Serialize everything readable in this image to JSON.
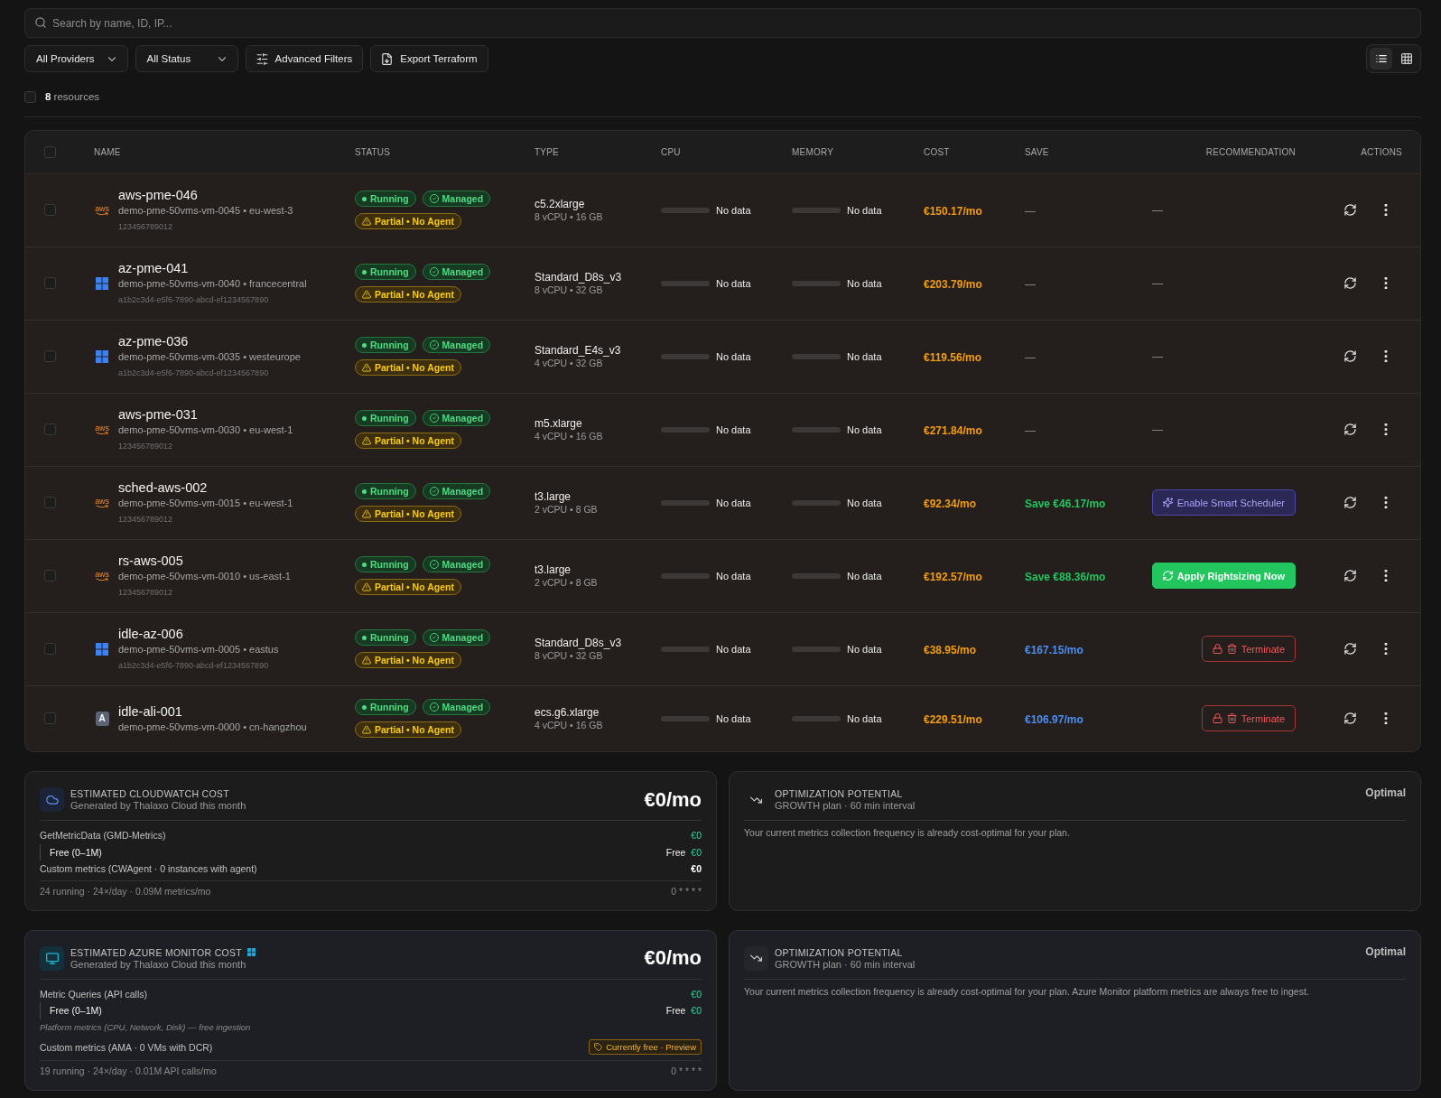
{
  "search": {
    "placeholder": "Search by name, ID, IP..."
  },
  "filters": [
    {
      "kind": "dropdown",
      "label": "All Providers"
    },
    {
      "kind": "dropdown",
      "label": "All Status"
    },
    {
      "kind": "filters",
      "label": "Advanced Filters"
    },
    {
      "kind": "export",
      "label": "Export Terraform"
    }
  ],
  "view_modes": [
    {
      "kind": "list",
      "selected": true
    },
    {
      "kind": "grid",
      "selected": false
    }
  ],
  "selection": {
    "checked": false,
    "count": "**8** resources"
  },
  "table": {
    "select_all": {
      "checked": false
    },
    "columns": [
      "NAME",
      "STATUS",
      "TYPE",
      "CPU",
      "MEMORY",
      "COST",
      "SAVE",
      "RECOMMENDATION",
      "ACTIONS"
    ],
    "rows": [
      {
        "checked": false,
        "provider": {
          "kind": "aws",
          "logo_text": "aws"
        },
        "name": "aws-pme-046",
        "detail": "demo-pme-50vms-vm-0045 • eu-west-3",
        "account": "123456789012",
        "badges": [
          {
            "kind": "running",
            "label": "Running"
          },
          {
            "kind": "managed",
            "label": "Managed"
          },
          {
            "kind": "partial",
            "label": "Partial • No Agent"
          }
        ],
        "type": "c5.2xlarge",
        "specs": "8 vCPU • 16 GB",
        "cpu": {
          "reading": "No data"
        },
        "memory": {
          "reading": "No data"
        },
        "cost": "€150.17/mo",
        "save": {
          "kind": "none",
          "text": "—"
        },
        "recommendation": {
          "kind": "none",
          "text": "—"
        }
      },
      {
        "checked": false,
        "provider": {
          "kind": "azure"
        },
        "name": "az-pme-041",
        "detail": "demo-pme-50vms-vm-0040 • francecentral",
        "account": "a1b2c3d4-e5f6-7890-abcd-ef1234567890",
        "badges": [
          {
            "kind": "running",
            "label": "Running"
          },
          {
            "kind": "managed",
            "label": "Managed"
          },
          {
            "kind": "partial",
            "label": "Partial • No Agent"
          }
        ],
        "type": "Standard_D8s_v3",
        "specs": "8 vCPU • 32 GB",
        "cpu": {
          "reading": "No data"
        },
        "memory": {
          "reading": "No data"
        },
        "cost": "€203.79/mo",
        "save": {
          "kind": "none",
          "text": "—"
        },
        "recommendation": {
          "kind": "none",
          "text": "—"
        }
      },
      {
        "checked": false,
        "provider": {
          "kind": "azure"
        },
        "name": "az-pme-036",
        "detail": "demo-pme-50vms-vm-0035 • westeurope",
        "account": "a1b2c3d4-e5f6-7890-abcd-ef1234567890",
        "badges": [
          {
            "kind": "running",
            "label": "Running"
          },
          {
            "kind": "managed",
            "label": "Managed"
          },
          {
            "kind": "partial",
            "label": "Partial • No Agent"
          }
        ],
        "type": "Standard_E4s_v3",
        "specs": "4 vCPU • 32 GB",
        "cpu": {
          "reading": "No data"
        },
        "memory": {
          "reading": "No data"
        },
        "cost": "€119.56/mo",
        "save": {
          "kind": "none",
          "text": "—"
        },
        "recommendation": {
          "kind": "none",
          "text": "—"
        }
      },
      {
        "checked": false,
        "provider": {
          "kind": "aws",
          "logo_text": "aws"
        },
        "name": "aws-pme-031",
        "detail": "demo-pme-50vms-vm-0030 • eu-west-1",
        "account": "123456789012",
        "badges": [
          {
            "kind": "running",
            "label": "Running"
          },
          {
            "kind": "managed",
            "label": "Managed"
          },
          {
            "kind": "partial",
            "label": "Partial • No Agent"
          }
        ],
        "type": "m5.xlarge",
        "specs": "4 vCPU • 16 GB",
        "cpu": {
          "reading": "No data"
        },
        "memory": {
          "reading": "No data"
        },
        "cost": "€271.84/mo",
        "save": {
          "kind": "none",
          "text": "—"
        },
        "recommendation": {
          "kind": "none",
          "text": "—"
        }
      },
      {
        "checked": false,
        "provider": {
          "kind": "aws",
          "logo_text": "aws"
        },
        "name": "sched-aws-002",
        "detail": "demo-pme-50vms-vm-0015 • eu-west-1",
        "account": "123456789012",
        "badges": [
          {
            "kind": "running",
            "label": "Running"
          },
          {
            "kind": "managed",
            "label": "Managed"
          },
          {
            "kind": "partial",
            "label": "Partial • No Agent"
          }
        ],
        "type": "t3.large",
        "specs": "2 vCPU • 8 GB",
        "cpu": {
          "reading": "No data"
        },
        "memory": {
          "reading": "No data"
        },
        "cost": "€92.34/mo",
        "save": {
          "kind": "saving",
          "text": "Save €46.17/mo"
        },
        "recommendation": {
          "kind": "scheduler",
          "text": "Enable Smart Scheduler"
        }
      },
      {
        "checked": false,
        "provider": {
          "kind": "aws",
          "logo_text": "aws"
        },
        "name": "rs-aws-005",
        "detail": "demo-pme-50vms-vm-0010 • us-east-1",
        "account": "123456789012",
        "badges": [
          {
            "kind": "running",
            "label": "Running"
          },
          {
            "kind": "managed",
            "label": "Managed"
          },
          {
            "kind": "partial",
            "label": "Partial • No Agent"
          }
        ],
        "type": "t3.large",
        "specs": "2 vCPU • 8 GB",
        "cpu": {
          "reading": "No data"
        },
        "memory": {
          "reading": "No data"
        },
        "cost": "€192.57/mo",
        "save": {
          "kind": "saving",
          "text": "Save €88.36/mo"
        },
        "recommendation": {
          "kind": "rightsizing",
          "text": "Apply Rightsizing Now"
        }
      },
      {
        "checked": false,
        "provider": {
          "kind": "azure"
        },
        "name": "idle-az-006",
        "detail": "demo-pme-50vms-vm-0005 • eastus",
        "account": "a1b2c3d4-e5f6-7890-abcd-ef1234567890",
        "badges": [
          {
            "kind": "running",
            "label": "Running"
          },
          {
            "kind": "managed",
            "label": "Managed"
          },
          {
            "kind": "partial",
            "label": "Partial • No Agent"
          }
        ],
        "type": "Standard_D8s_v3",
        "specs": "8 vCPU • 32 GB",
        "cpu": {
          "reading": "No data"
        },
        "memory": {
          "reading": "No data"
        },
        "cost": "€38.95/mo",
        "save": {
          "kind": "idle",
          "text": "€167.15/mo"
        },
        "recommendation": {
          "kind": "terminate",
          "text": "Terminate"
        }
      },
      {
        "checked": false,
        "provider": {
          "kind": "alibaba",
          "logo_text": "A"
        },
        "name": "idle-ali-001",
        "detail": "demo-pme-50vms-vm-0000 • cn-hangzhou",
        "badges": [
          {
            "kind": "running",
            "label": "Running"
          },
          {
            "kind": "managed",
            "label": "Managed"
          },
          {
            "kind": "partial",
            "label": "Partial • No Agent"
          }
        ],
        "type": "ecs.g6.xlarge",
        "specs": "4 vCPU • 16 GB",
        "cpu": {
          "reading": "No data"
        },
        "memory": {
          "reading": "No data"
        },
        "cost": "€229.51/mo",
        "save": {
          "kind": "idle",
          "text": "€106.97/mo"
        },
        "recommendation": {
          "kind": "terminate",
          "text": "Terminate"
        }
      }
    ]
  },
  "monitoring_panels": [
    {
      "kind": "cloudwatch",
      "cost_card": {
        "title": "ESTIMATED CLOUDWATCH COST",
        "subtitle": "Generated by Thalaxo Cloud this month",
        "amount": "€0/mo",
        "lines": [
          {
            "kind": "item",
            "label": "GetMetricData (GMD-Metrics)",
            "value": "€0",
            "highlight": true
          },
          {
            "kind": "tier",
            "label": "Free (0–1M)",
            "tag": "Free",
            "value": "€0",
            "highlight": true
          },
          {
            "kind": "item",
            "label": "Custom metrics (CWAgent · 0 instances with agent)",
            "value": "€0",
            "highlight": false
          }
        ],
        "footer": "24 running · 24×/day · 0.09M metrics/mo",
        "schedule": "0 * * * *"
      },
      "optimization_card": {
        "title": "OPTIMIZATION POTENTIAL",
        "subtitle": "GROWTH plan · 60 min interval",
        "status": "Optimal",
        "message": "Your current metrics collection frequency is already cost-optimal for your plan."
      }
    },
    {
      "kind": "azure_monitor",
      "cost_card": {
        "title": "ESTIMATED AZURE MONITOR COST",
        "subtitle": "Generated by Thalaxo Cloud this month",
        "amount": "€0/mo",
        "lines": [
          {
            "kind": "item",
            "label": "Metric Queries (API calls)",
            "value": "€0",
            "highlight": true
          },
          {
            "kind": "tier",
            "label": "Free (0–1M)",
            "tag": "Free",
            "value": "€0",
            "highlight": true
          },
          {
            "kind": "note",
            "text": "Platform metrics (CPU, Network, Disk) — free ingestion"
          },
          {
            "kind": "badge_item",
            "label": "Custom metrics (AMA · 0 VMs with DCR)",
            "badge": "Currently free · Preview"
          }
        ],
        "footer": "19 running · 24×/day · 0.01M API calls/mo",
        "schedule": "0 * * * *"
      },
      "optimization_card": {
        "title": "OPTIMIZATION POTENTIAL",
        "subtitle": "GROWTH plan · 60 min interval",
        "status": "Optimal",
        "message": "Your current metrics collection frequency is already cost-optimal for your plan. Azure Monitor platform metrics are always free to ingest."
      }
    }
  ]
}
